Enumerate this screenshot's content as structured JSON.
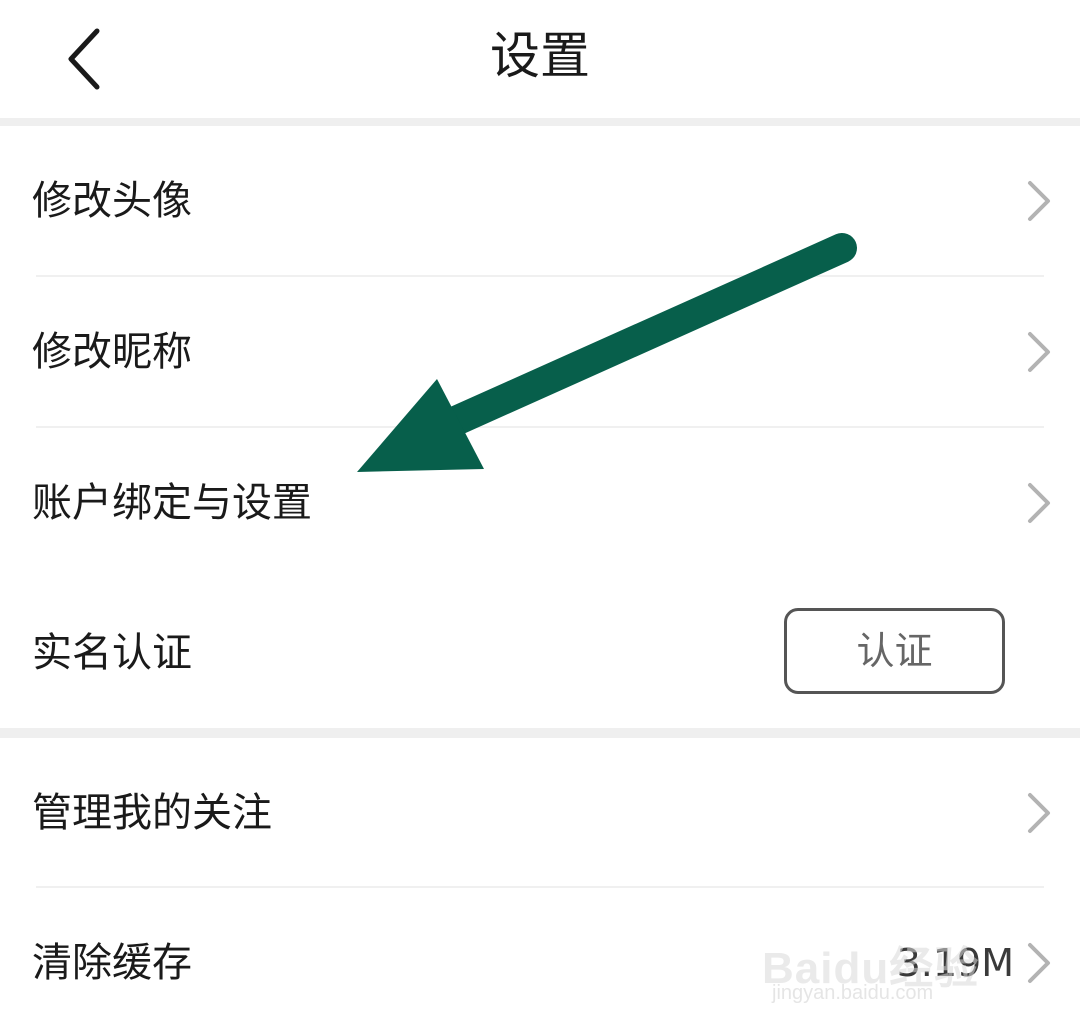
{
  "header": {
    "title": "设置",
    "back_icon": "chevron-left-icon"
  },
  "section1": {
    "items": [
      {
        "label": "修改头像",
        "icon": "chevron-right-icon"
      },
      {
        "label": "修改昵称",
        "icon": "chevron-right-icon"
      },
      {
        "label": "账户绑定与设置",
        "icon": "chevron-right-icon"
      },
      {
        "label": "实名认证",
        "button_label": "认证"
      }
    ]
  },
  "section2": {
    "items": [
      {
        "label": "管理我的关注",
        "icon": "chevron-right-icon"
      },
      {
        "label": "清除缓存",
        "value": "3.19M",
        "icon": "chevron-right-icon"
      }
    ]
  },
  "annotation": {
    "arrow_color": "#075f4b",
    "arrow_icon": "arrow-pointing-icon"
  },
  "watermark": {
    "brand": "Baidu经验",
    "url": "jingyan.baidu.com"
  },
  "colors": {
    "background": "#ffffff",
    "section_gap": "#efefef",
    "text_primary": "#1a1a1a",
    "chevron": "#b3b3b3",
    "button_border": "#555555"
  }
}
